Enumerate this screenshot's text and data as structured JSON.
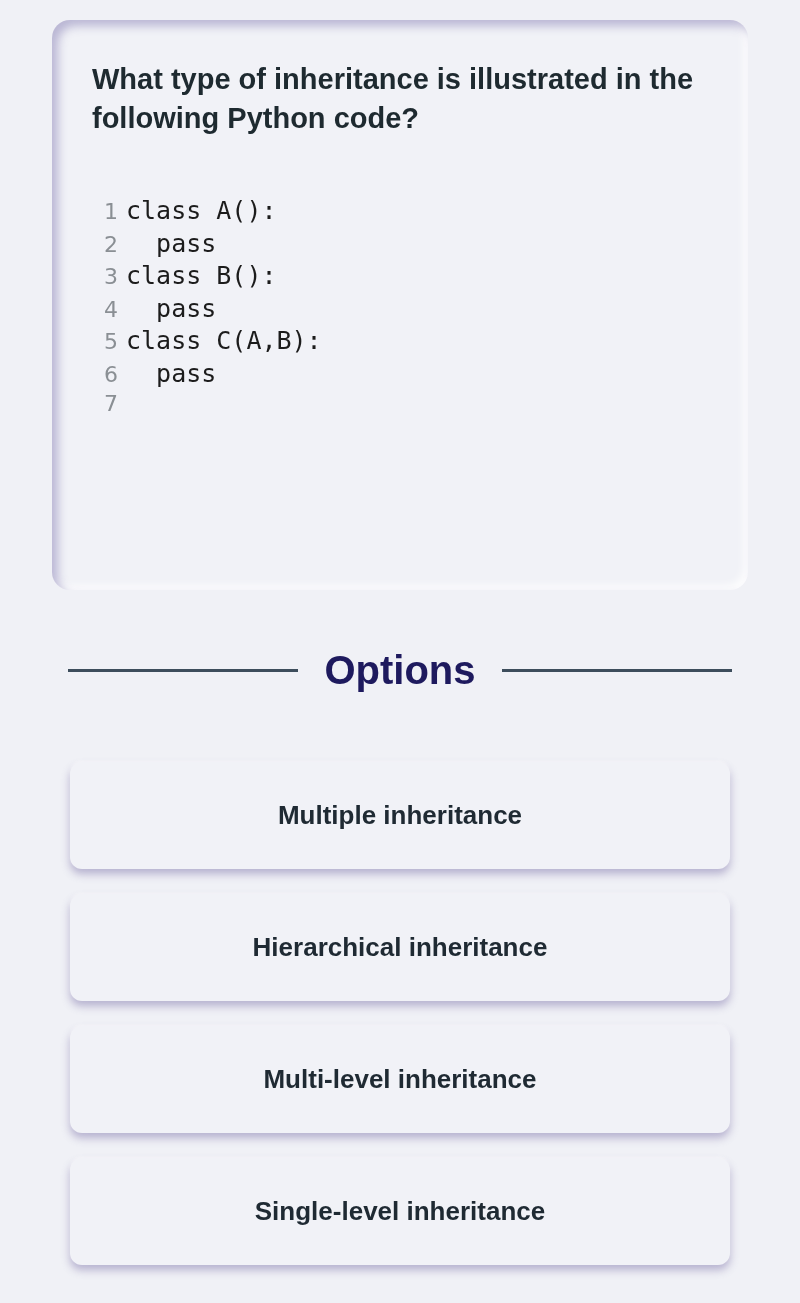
{
  "question": {
    "text": "What type of inheritance is illustrated in the following Python code?",
    "code_lines": [
      {
        "number": "1",
        "code": "class A():"
      },
      {
        "number": "2",
        "code": "  pass"
      },
      {
        "number": "3",
        "code": "class B():"
      },
      {
        "number": "4",
        "code": "  pass"
      },
      {
        "number": "5",
        "code": "class C(A,B):"
      },
      {
        "number": "6",
        "code": "  pass"
      },
      {
        "number": "7"
      }
    ]
  },
  "options_heading": "Options",
  "options": [
    {
      "label": "Multiple inheritance"
    },
    {
      "label": "Hierarchical inheritance"
    },
    {
      "label": "Multi-level inheritance"
    },
    {
      "label": "Single-level inheritance"
    }
  ]
}
